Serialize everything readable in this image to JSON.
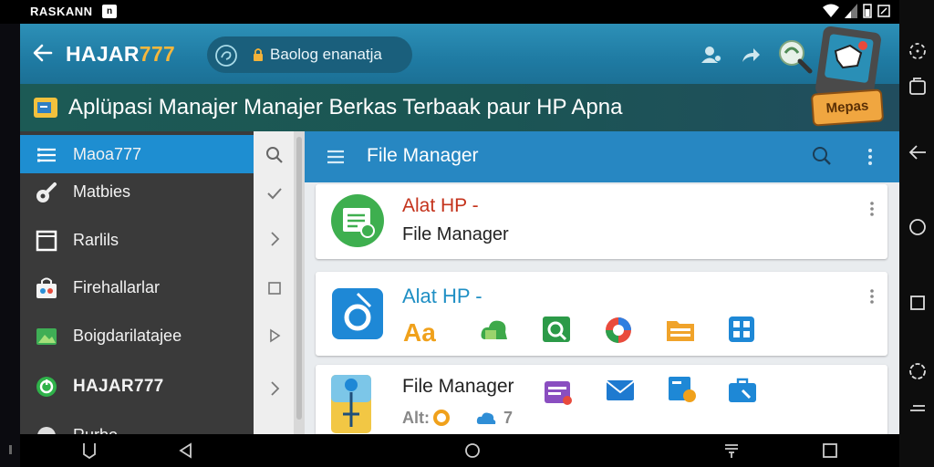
{
  "status_bar": {
    "carrier": "RASKANN",
    "chip": "n"
  },
  "header": {
    "title_main": "HAJAR",
    "title_accent": "777",
    "search_text": "Baolog enanatja"
  },
  "banner": {
    "text": "Aplüpasi Manajer Manajer Berkas Terbaak paur HP Apna"
  },
  "badge": {
    "label": "Mepas"
  },
  "sidebar": {
    "items": [
      {
        "label": "Maoa777",
        "icon": "list-icon",
        "active": true
      },
      {
        "label": "Matbies",
        "icon": "tools-icon"
      },
      {
        "label": "Rarlils",
        "icon": "square-icon"
      },
      {
        "label": "Firehallarlar",
        "icon": "store-bag-icon"
      },
      {
        "label": "Boigdarilatajee",
        "icon": "image-icon"
      },
      {
        "label": "HAJAR777",
        "icon": "refresh-icon"
      },
      {
        "label": "Rurbo",
        "icon": "app-icon"
      }
    ]
  },
  "main": {
    "toolbar_title": "File Manager",
    "cards": [
      {
        "title": "Alat HP -",
        "subtitle": "File Manager"
      },
      {
        "title": "Alat HP -",
        "app_text": "Aa"
      },
      {
        "title": "File Manager",
        "extra": "Alt:",
        "number": "7"
      }
    ]
  },
  "colors": {
    "header": "#2188b3",
    "banner": "#1c5a55",
    "sidebar": "#3a3a3a",
    "sidebar_active": "#1e8ed1",
    "toolbar": "#2787c2",
    "accent": "#f6b73c"
  }
}
